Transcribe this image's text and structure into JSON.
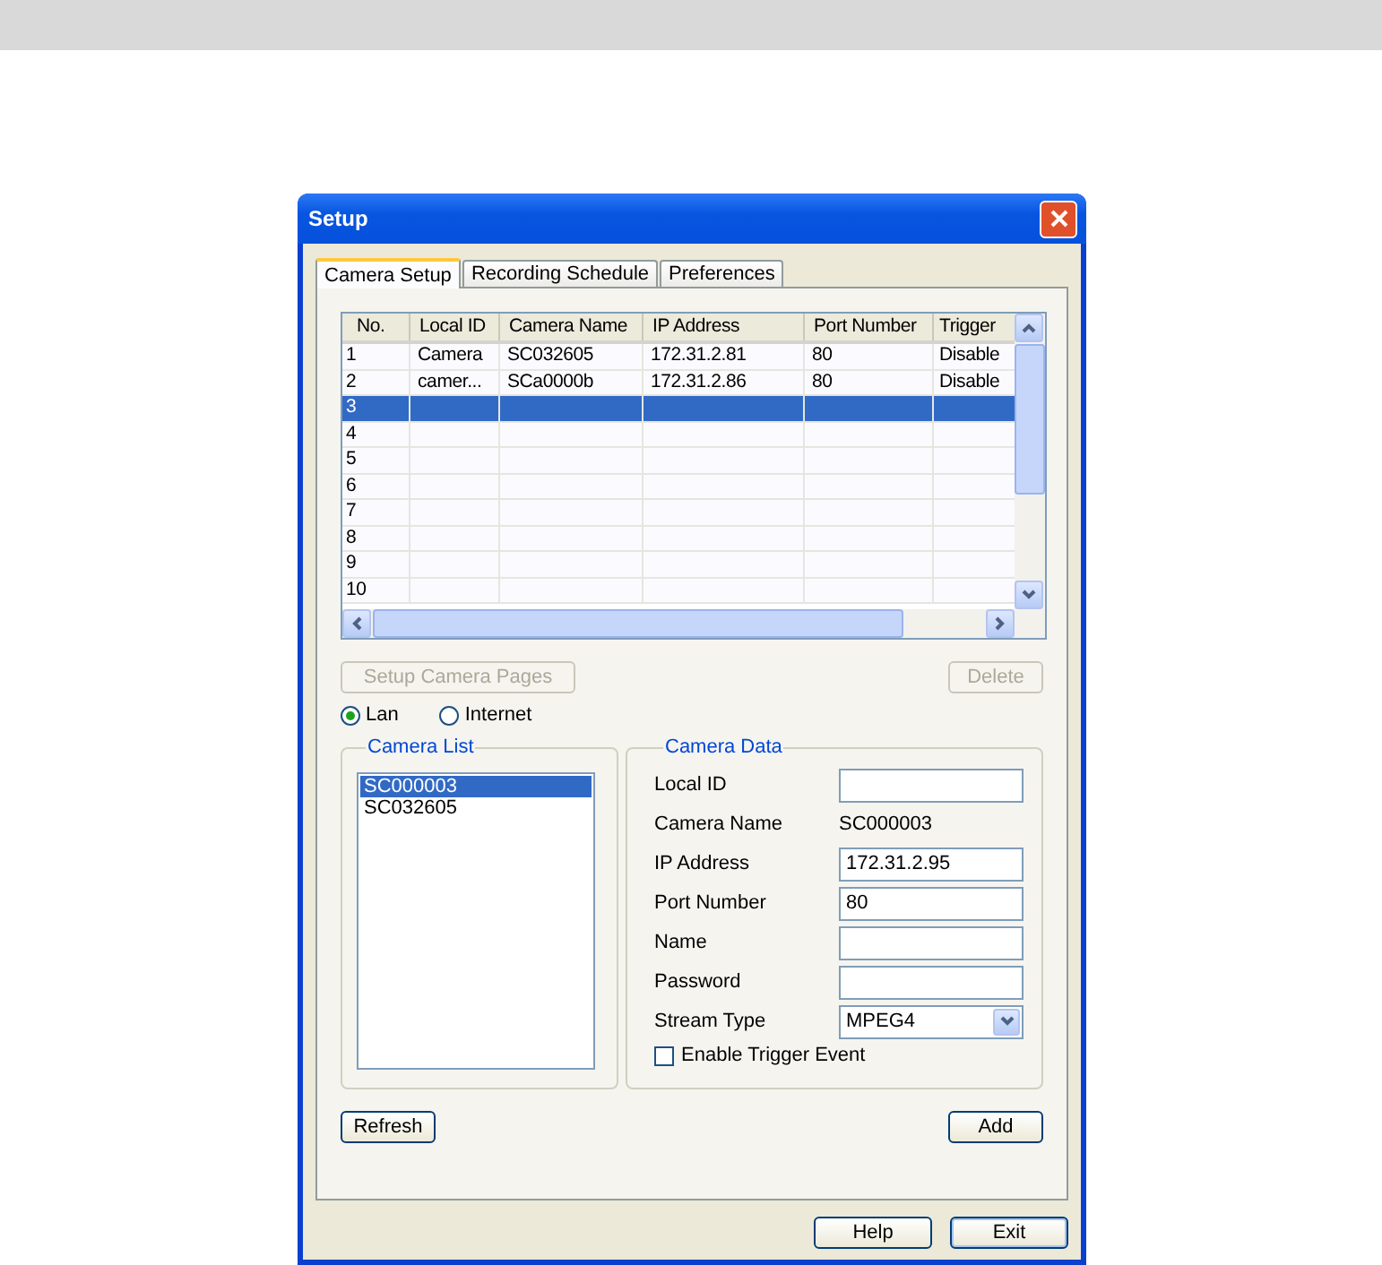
{
  "window": {
    "title": "Setup"
  },
  "tabs": [
    {
      "label": "Camera Setup",
      "selected": true
    },
    {
      "label": "Recording Schedule",
      "selected": false
    },
    {
      "label": "Preferences",
      "selected": false
    }
  ],
  "table": {
    "columns": [
      "No.",
      "Local ID",
      "Camera Name",
      "IP Address",
      "Port Number",
      "Trigger"
    ],
    "rows": [
      {
        "cells": [
          "1",
          "Camera",
          "SC032605",
          "172.31.2.81",
          "80",
          "Disable"
        ],
        "selected": false
      },
      {
        "cells": [
          "2",
          "camer...",
          "SCa0000b",
          "172.31.2.86",
          "80",
          "Disable"
        ],
        "selected": false
      },
      {
        "cells": [
          "3",
          "",
          "",
          "",
          "",
          ""
        ],
        "selected": true
      },
      {
        "cells": [
          "4",
          "",
          "",
          "",
          "",
          ""
        ],
        "selected": false
      },
      {
        "cells": [
          "5",
          "",
          "",
          "",
          "",
          ""
        ],
        "selected": false
      },
      {
        "cells": [
          "6",
          "",
          "",
          "",
          "",
          ""
        ],
        "selected": false
      },
      {
        "cells": [
          "7",
          "",
          "",
          "",
          "",
          ""
        ],
        "selected": false
      },
      {
        "cells": [
          "8",
          "",
          "",
          "",
          "",
          ""
        ],
        "selected": false
      },
      {
        "cells": [
          "9",
          "",
          "",
          "",
          "",
          ""
        ],
        "selected": false
      },
      {
        "cells": [
          "10",
          "",
          "",
          "",
          "",
          ""
        ],
        "selected": false
      }
    ]
  },
  "table_buttons": [
    {
      "label": "Setup Camera Pages",
      "disabled": true
    },
    {
      "label": "Delete",
      "disabled": true
    }
  ],
  "connection": [
    {
      "label": "Lan",
      "selected": true
    },
    {
      "label": "Internet",
      "selected": false
    }
  ],
  "camera_list": {
    "title": "Camera List",
    "items": [
      {
        "label": "SC000003",
        "selected": true
      },
      {
        "label": "SC032605",
        "selected": false
      }
    ]
  },
  "camera_data": {
    "title": "Camera Data",
    "fields": [
      {
        "label": "Local ID",
        "kind": "input"
      },
      {
        "label": "Camera Name",
        "kind": "text",
        "value": "SC000003"
      },
      {
        "label": "IP Address",
        "kind": "input",
        "value": "172.31.2.95"
      },
      {
        "label": "Port Number",
        "kind": "input",
        "value": "80"
      },
      {
        "label": "Name",
        "kind": "input"
      },
      {
        "label": "Password",
        "kind": "input"
      },
      {
        "label": "Stream Type",
        "kind": "select",
        "value": "MPEG4"
      }
    ],
    "checkbox": {
      "label": "Enable Trigger Event",
      "checked": false
    }
  },
  "panel_buttons": [
    "Refresh",
    "Add"
  ],
  "dialog_buttons": [
    "Help",
    "Exit"
  ]
}
